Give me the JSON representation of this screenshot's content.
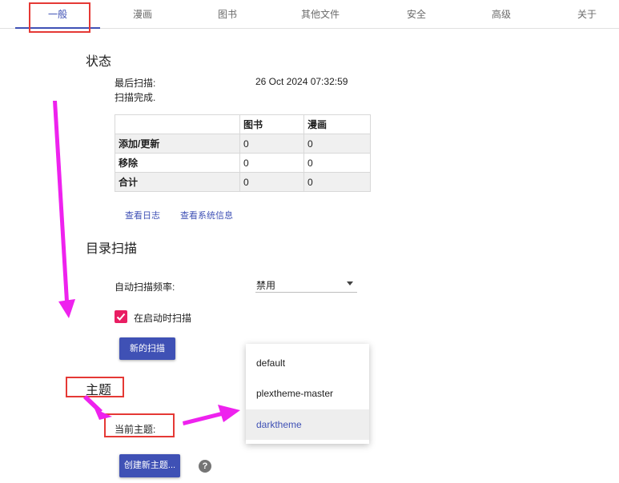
{
  "tabs": [
    "一般",
    "漫画",
    "图书",
    "其他文件",
    "安全",
    "高级",
    "关于"
  ],
  "status": {
    "title": "状态",
    "last_scan_label": "最后扫描:",
    "last_scan_value": "26 Oct 2024 07:32:59",
    "scan_state": "扫描完成."
  },
  "stats_table": {
    "headers": [
      "",
      "图书",
      "漫画"
    ],
    "rows": [
      {
        "label": "添加/更新",
        "books": "0",
        "comics": "0"
      },
      {
        "label": "移除",
        "books": "0",
        "comics": "0"
      },
      {
        "label": "合计",
        "books": "0",
        "comics": "0"
      }
    ]
  },
  "links": {
    "view_log": "查看日志",
    "view_system_info": "查看系统信息"
  },
  "dir_scan": {
    "title": "目录扫描",
    "auto_scan_label": "自动扫描频率:",
    "auto_scan_value": "禁用",
    "scan_on_start_label": "在启动时扫描",
    "new_scan_button": "新的扫描"
  },
  "theme": {
    "title": "主题",
    "current_theme_label": "当前主题:",
    "create_button": "创建新主题...",
    "help_symbol": "?",
    "options": [
      "default",
      "plextheme-master",
      "darktheme"
    ],
    "selected_option": "darktheme"
  },
  "colors": {
    "accent": "#3f51b5",
    "checkbox": "#e91e63",
    "annotation_box": "#e53935",
    "annotation_arrow": "#ee22ee"
  },
  "icons": {
    "checkbox": "check-icon",
    "select": "caret-down-icon",
    "help": "help-circle-icon"
  }
}
